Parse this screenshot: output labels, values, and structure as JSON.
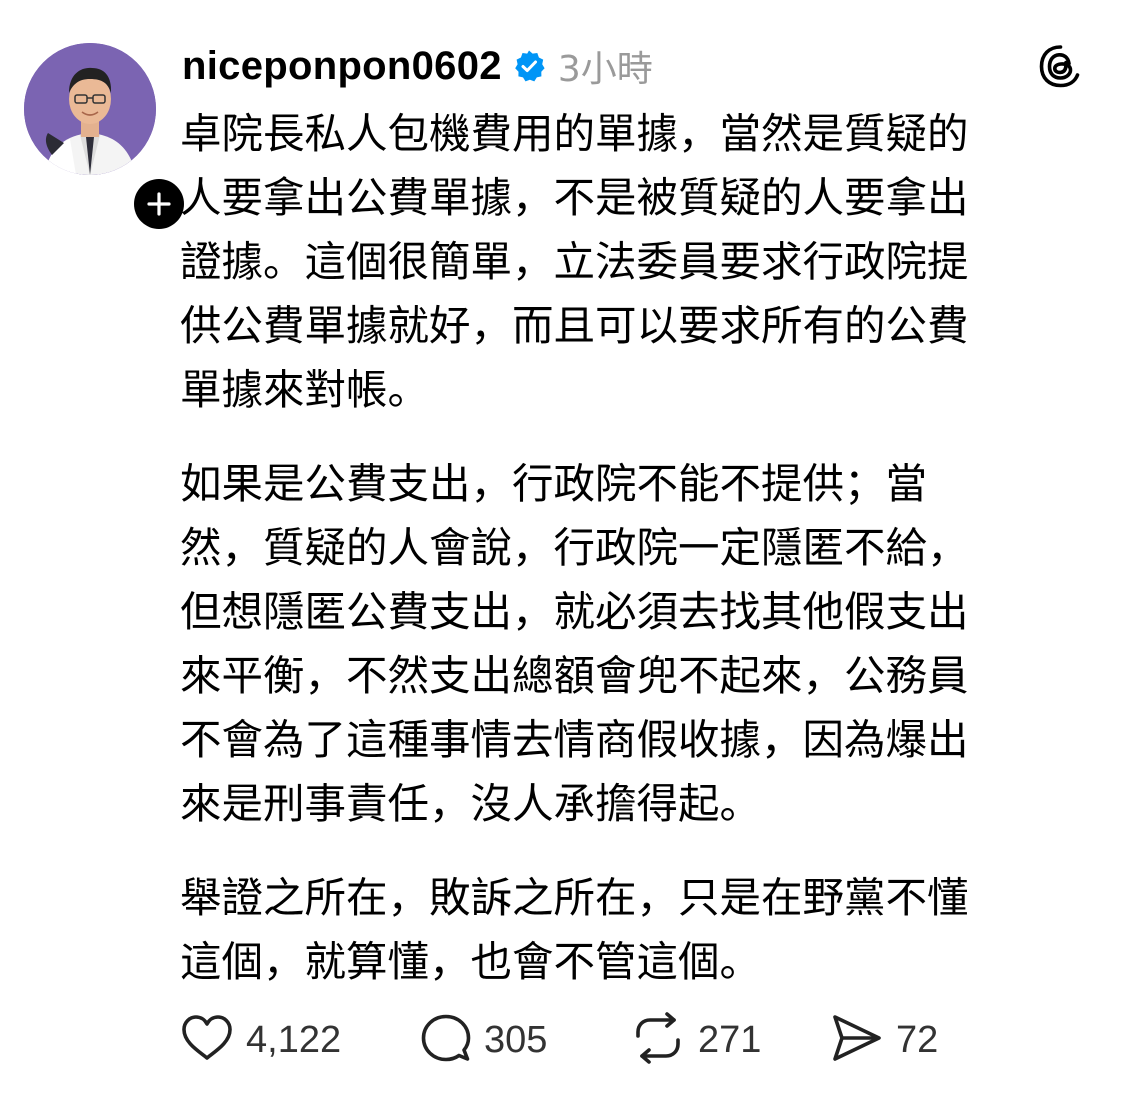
{
  "post": {
    "username": "niceponpon0602",
    "timestamp": "3小時",
    "paragraphs": [
      {
        "lines": [
          "卓院長私人包機費用的單據，當然是質疑的",
          "人要拿出公費單據，不是被質疑的人要拿出",
          "證據。這個很簡單，立法委員要求行政院提",
          "供公費單據就好，而且可以要求所有的公費",
          "單據來對帳。"
        ]
      },
      {
        "lines": [
          "如果是公費支出，行政院不能不提供；當",
          "然，質疑的人會說，行政院一定隱匿不給，",
          "但想隱匿公費支出，就必須去找其他假支出",
          "來平衡，不然支出總額會兜不起來，公務員",
          "不會為了這種事情去情商假收據，因為爆出",
          "來是刑事責任，沒人承擔得起。"
        ]
      },
      {
        "lines": [
          "舉證之所在，敗訴之所在，只是在野黨不懂",
          "這個，就算懂，也會不管這個。"
        ]
      }
    ]
  },
  "actions": {
    "likes": "4,122",
    "replies": "305",
    "reposts": "271",
    "shares": "72"
  },
  "icons": {
    "verified": "verified-badge-icon",
    "follow": "plus-icon",
    "logo": "threads-logo-icon",
    "like": "heart-icon",
    "reply": "comment-bubble-icon",
    "repost": "repost-icon",
    "share": "send-icon"
  },
  "colors": {
    "verified": "#0095f6",
    "timestamp": "#9a9a9a",
    "avatar_bg": "#7b64b2"
  }
}
